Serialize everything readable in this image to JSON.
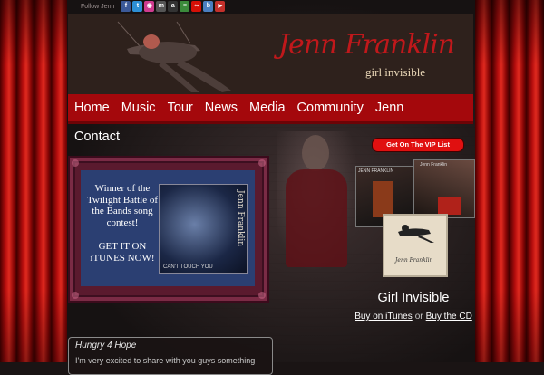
{
  "social": {
    "label": "Follow Jenn",
    "icons": [
      "facebook-icon",
      "twitter-icon",
      "flickr-icon",
      "myspace-icon",
      "amazon-icon",
      "spotify-icon",
      "lastfm-icon",
      "blog-icon",
      "youtube-icon"
    ]
  },
  "header": {
    "artist_name": "Jenn Franklin",
    "tagline": "girl invisible"
  },
  "nav": {
    "items": [
      "Home",
      "Music",
      "Tour",
      "News",
      "Media",
      "Community",
      "Jenn"
    ],
    "overflow_item": "Contact"
  },
  "promo": {
    "headline": "Winner of the Twilight Battle of the Bands song contest!",
    "cta": "GET IT ON iTUNES NOW!",
    "cover_artist": "Jenn Franklin",
    "cover_song": "CAN'T TOUCH YOU"
  },
  "vip": {
    "label": "Get On The VIP List"
  },
  "albums": {
    "album1_title": "JENN FRANKLIN",
    "album2_title": "Jenn Franklin",
    "album3_title": "Jenn Franklin"
  },
  "release": {
    "title": "Girl Invisible",
    "itunes_link": "Buy on iTunes",
    "or_text": "or",
    "cd_link": "Buy the CD"
  },
  "post": {
    "title": "Hungry 4 Hope",
    "excerpt": "I'm very excited to share with you guys something"
  },
  "colors": {
    "curtain_red": "#c0120f",
    "nav_red": "#a4080c",
    "vip_red": "#e01010",
    "logo_red": "#c0181b"
  }
}
